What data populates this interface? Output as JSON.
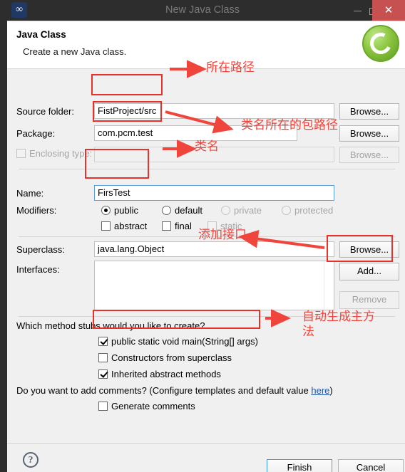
{
  "window": {
    "title": "New Java Class",
    "app_icon": "eclipse-icon",
    "buttons": {
      "minimize": "minimize-icon",
      "maximize": "maximize-icon",
      "close": "✕"
    }
  },
  "header": {
    "title": "Java Class",
    "subtitle": "Create a new Java class.",
    "icon": "java-class-wizard-icon"
  },
  "form": {
    "source_folder": {
      "label": "Source folder:",
      "value": "FistProject/src",
      "browse": "Browse..."
    },
    "package": {
      "label": "Package:",
      "value": "com.pcm.test",
      "browse": "Browse..."
    },
    "enclosing_type": {
      "label": "Enclosing type:",
      "value": "",
      "browse": "Browse...",
      "checked": false,
      "enabled": false
    },
    "name": {
      "label": "Name:",
      "value": "FirsTest"
    },
    "modifiers": {
      "label": "Modifiers:",
      "radios": [
        {
          "label": "public",
          "selected": true,
          "enabled": true
        },
        {
          "label": "default",
          "selected": false,
          "enabled": true
        },
        {
          "label": "private",
          "selected": false,
          "enabled": false
        },
        {
          "label": "protected",
          "selected": false,
          "enabled": false
        }
      ],
      "checks": [
        {
          "label": "abstract",
          "checked": false,
          "enabled": true
        },
        {
          "label": "final",
          "checked": false,
          "enabled": true
        },
        {
          "label": "static",
          "checked": false,
          "enabled": false
        }
      ]
    },
    "superclass": {
      "label": "Superclass:",
      "value": "java.lang.Object",
      "browse": "Browse..."
    },
    "interfaces": {
      "label": "Interfaces:",
      "items": [],
      "add": "Add...",
      "remove": "Remove"
    },
    "stubs": {
      "question": "Which method stubs would you like to create?",
      "options": [
        {
          "label": "public static void main(String[] args)",
          "checked": true
        },
        {
          "label": "Constructors from superclass",
          "checked": false
        },
        {
          "label": "Inherited abstract methods",
          "checked": true
        }
      ]
    },
    "comments": {
      "question_prefix": "Do you want to add comments? (Configure templates and default value ",
      "link": "here",
      "question_suffix": ")",
      "option": {
        "label": "Generate comments",
        "checked": false
      }
    }
  },
  "footer": {
    "help": "?",
    "finish": "Finish",
    "cancel": "Cancel"
  },
  "annotations": {
    "path": "所在路径",
    "package_path": "类名所在的包路径",
    "class_name": "类名",
    "add_interface": "添加接口",
    "main_method": "自动生成主方\n法"
  },
  "colors": {
    "annotation_red": "#f0453c",
    "close_button": "#c75050",
    "titlebar": "#2d2d2d",
    "dialog_bg": "#f0f0f0",
    "focus_blue": "#5b9ddb",
    "link_blue": "#2255aa"
  }
}
